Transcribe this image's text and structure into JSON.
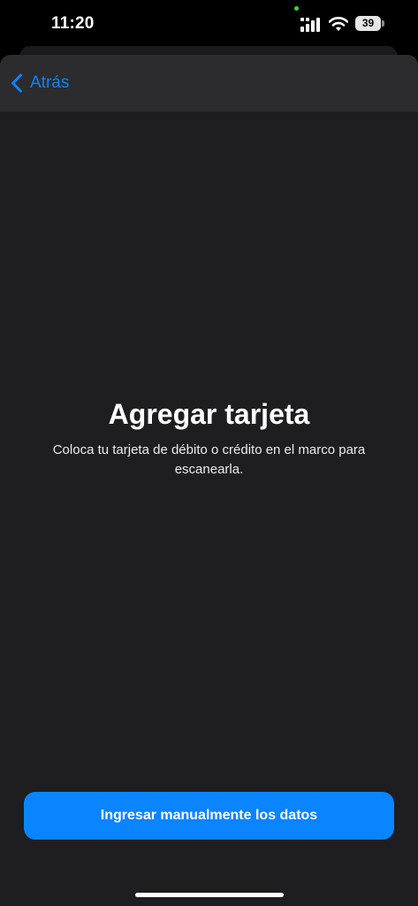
{
  "status_bar": {
    "time": "11:20",
    "battery_level": "39",
    "icons": [
      "signal-icon",
      "wifi-icon",
      "battery-icon"
    ],
    "camera_indicator_color": "#32d74b"
  },
  "nav": {
    "back_label": "Atrás",
    "back_icon": "chevron-left-icon"
  },
  "main": {
    "title": "Agregar tarjeta",
    "subtitle": "Coloca tu tarjeta de débito o crédito en el marco para escanearla."
  },
  "actions": {
    "manual_entry_label": "Ingresar manualmente los datos"
  },
  "colors": {
    "accent": "#0a84ff",
    "background": "#1e1e20",
    "nav_background": "#2c2c2e"
  }
}
